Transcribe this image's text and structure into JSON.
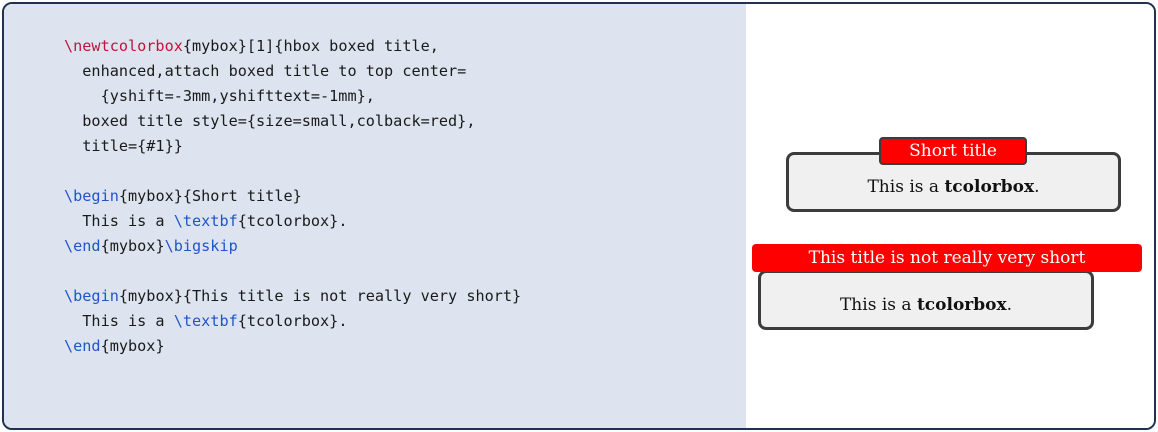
{
  "code": {
    "lines": [
      [
        {
          "t": "\\newtcolorbox",
          "c": "red"
        },
        {
          "t": "{mybox}[1]{hbox boxed title,"
        }
      ],
      [
        {
          "t": "  enhanced,attach boxed title to top center="
        }
      ],
      [
        {
          "t": "    {yshift=-3mm,yshifttext=-1mm},"
        }
      ],
      [
        {
          "t": "  boxed title style={size=small,colback=red},"
        }
      ],
      [
        {
          "t": "  title={#1}}"
        }
      ],
      [],
      [
        {
          "t": "\\begin",
          "c": "blue"
        },
        {
          "t": "{mybox}{Short title}"
        }
      ],
      [
        {
          "t": "  This is a "
        },
        {
          "t": "\\textbf",
          "c": "blue"
        },
        {
          "t": "{tcolorbox}."
        }
      ],
      [
        {
          "t": "\\end",
          "c": "blue"
        },
        {
          "t": "{mybox}"
        },
        {
          "t": "\\bigskip",
          "c": "blue"
        }
      ],
      [],
      [
        {
          "t": "\\begin",
          "c": "blue"
        },
        {
          "t": "{mybox}{This title is not really very short}"
        }
      ],
      [
        {
          "t": "  This is a "
        },
        {
          "t": "\\textbf",
          "c": "blue"
        },
        {
          "t": "{tcolorbox}."
        }
      ],
      [
        {
          "t": "\\end",
          "c": "blue"
        },
        {
          "t": "{mybox}"
        }
      ]
    ]
  },
  "output": {
    "box1": {
      "title": "Short title",
      "body_prefix": "This is a ",
      "body_bold": "tcolorbox",
      "body_suffix": "."
    },
    "box2": {
      "title": "This title is not really very short",
      "body_prefix": "This is a ",
      "body_bold": "tcolorbox",
      "body_suffix": "."
    }
  },
  "colors": {
    "frame": "#1f3350",
    "code_background": "#dde4ef",
    "keyword_red": "#c0143c",
    "keyword_blue": "#1f55c9",
    "title_background": "#ff0000",
    "box_border": "#3c3c3c",
    "box_background": "#f0f0f0"
  }
}
